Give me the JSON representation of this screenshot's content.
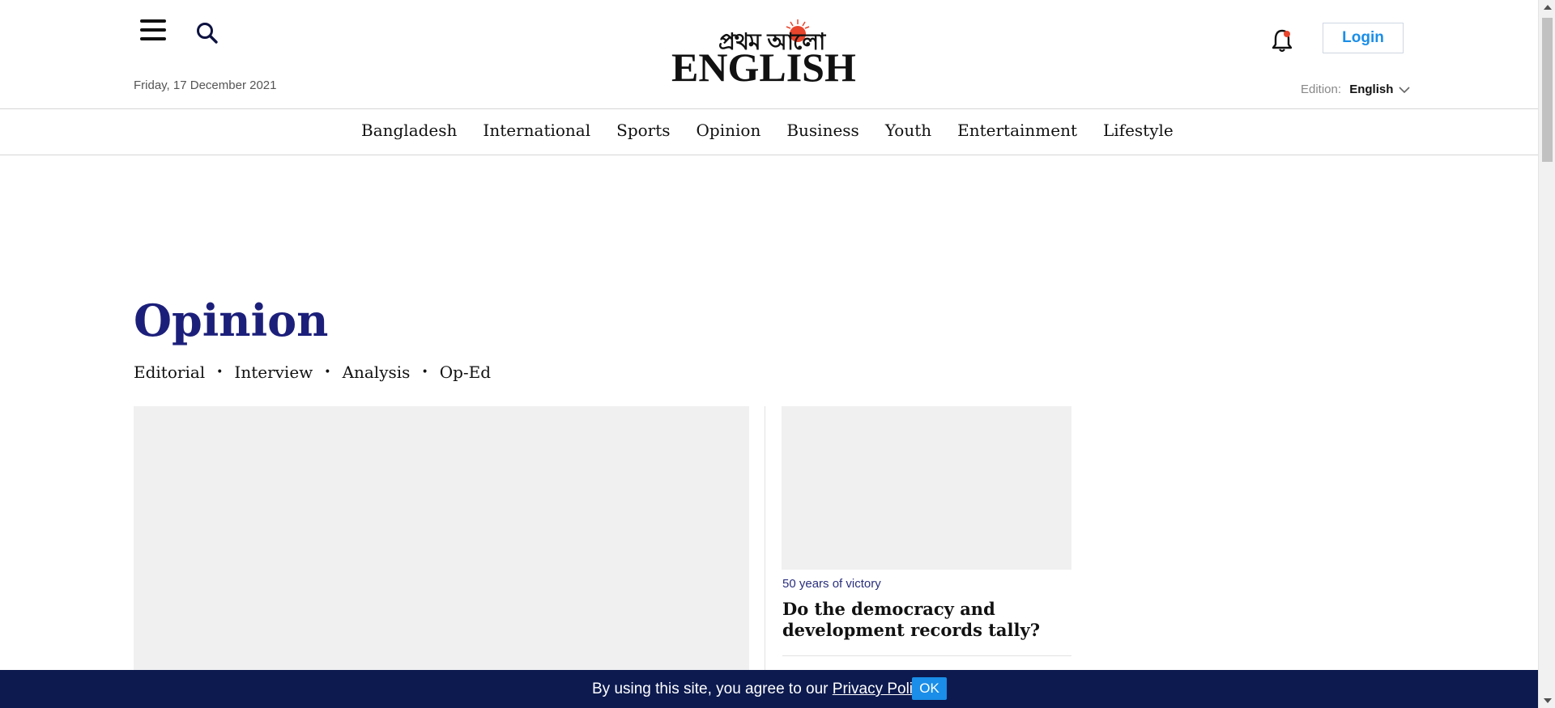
{
  "header": {
    "date": "Friday, 17 December 2021",
    "logo": {
      "bengali_text": "প্রথম আলো",
      "english_text": "ENGLISH"
    },
    "login_label": "Login",
    "edition_label": "Edition:",
    "edition_value": "English"
  },
  "nav": {
    "items": [
      "Bangladesh",
      "International",
      "Sports",
      "Opinion",
      "Business",
      "Youth",
      "Entertainment",
      "Lifestyle"
    ]
  },
  "section": {
    "title": "Opinion",
    "subnav": [
      "Editorial",
      "Interview",
      "Analysis",
      "Op-Ed"
    ]
  },
  "cards": [
    {
      "kicker": "50 years of victory",
      "title": "Do the democracy and development records tally?"
    }
  ],
  "cookie_bar": {
    "text_before": "By using this site, you agree to our ",
    "link": "Privacy Policy",
    "text_after": ".",
    "ok_label": "OK"
  },
  "colors": {
    "title_navy": "#1c1f7a",
    "link_blue": "#1a8ee8",
    "cookie_bg": "#0c1a4f",
    "sun_red": "#e8452c"
  },
  "icons": [
    "hamburger-icon",
    "search-icon",
    "bell-icon",
    "chevron-down-icon"
  ]
}
